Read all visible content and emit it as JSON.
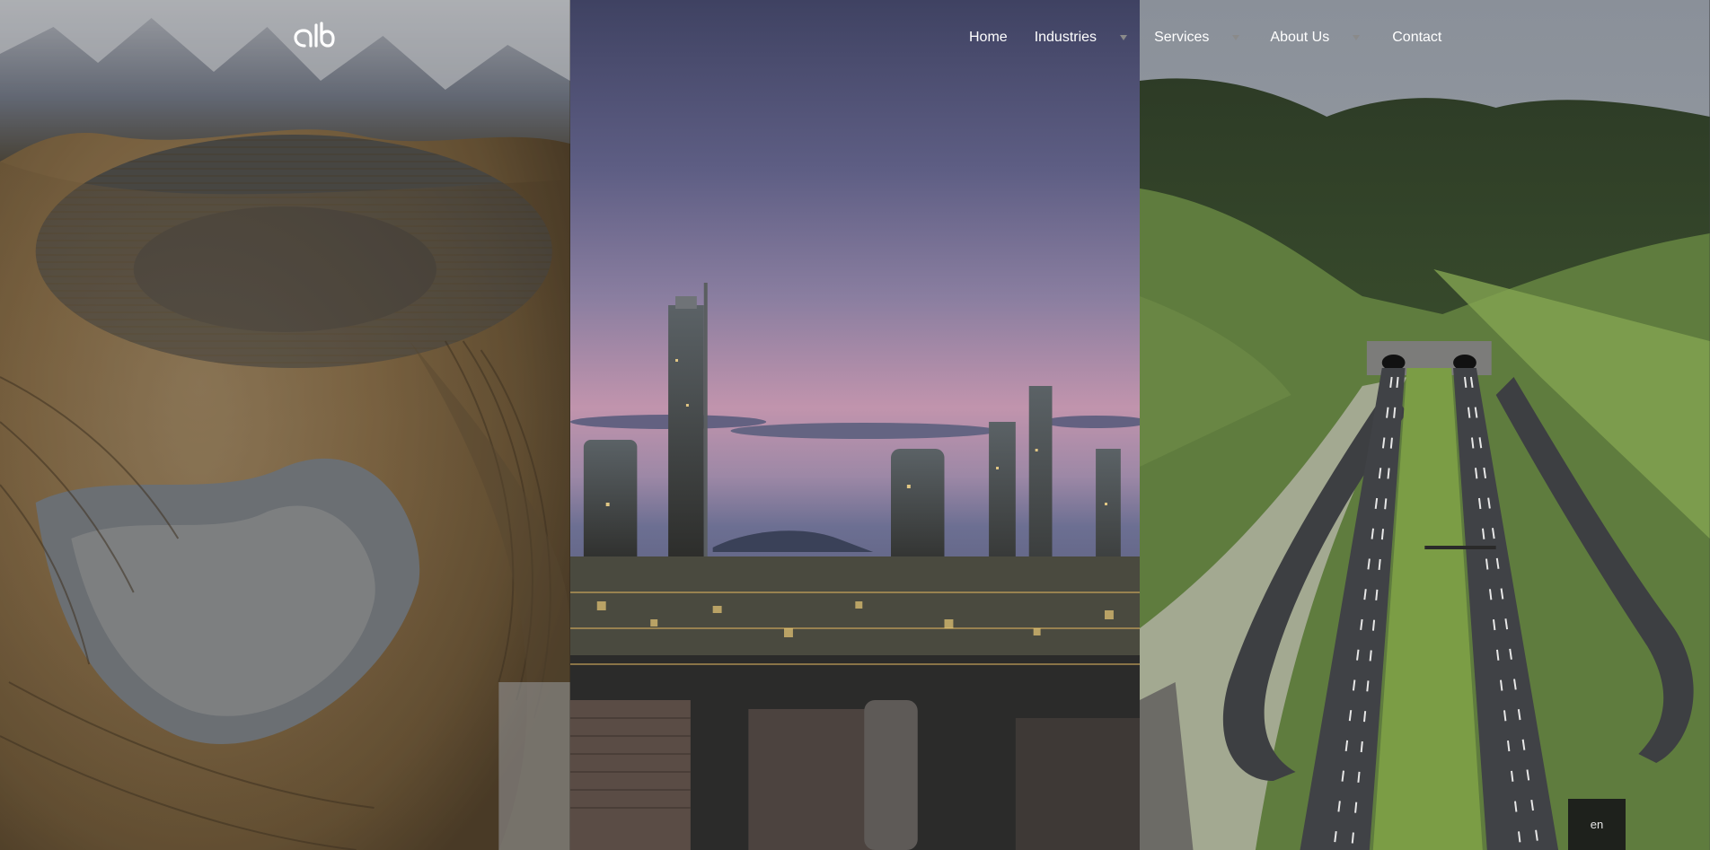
{
  "logo": {
    "text": "alb",
    "icon": "alb-logo-icon"
  },
  "nav": {
    "home": "Home",
    "industries": "Industries",
    "services": "Services",
    "about": "About Us",
    "contact": "Contact",
    "caret_icon": "triangle-down-icon"
  },
  "panels": [
    {
      "name": "mining",
      "icon": "open-pit-mine-photo"
    },
    {
      "name": "oil-gas",
      "icon": "refinery-at-dusk-photo"
    },
    {
      "name": "infrastructure",
      "icon": "highway-tunnel-photo"
    }
  ],
  "language": {
    "current": "en"
  },
  "colors": {
    "nav_text": "#ffffff",
    "caret": "#8a8a8a",
    "lang_bg": "#191919"
  }
}
